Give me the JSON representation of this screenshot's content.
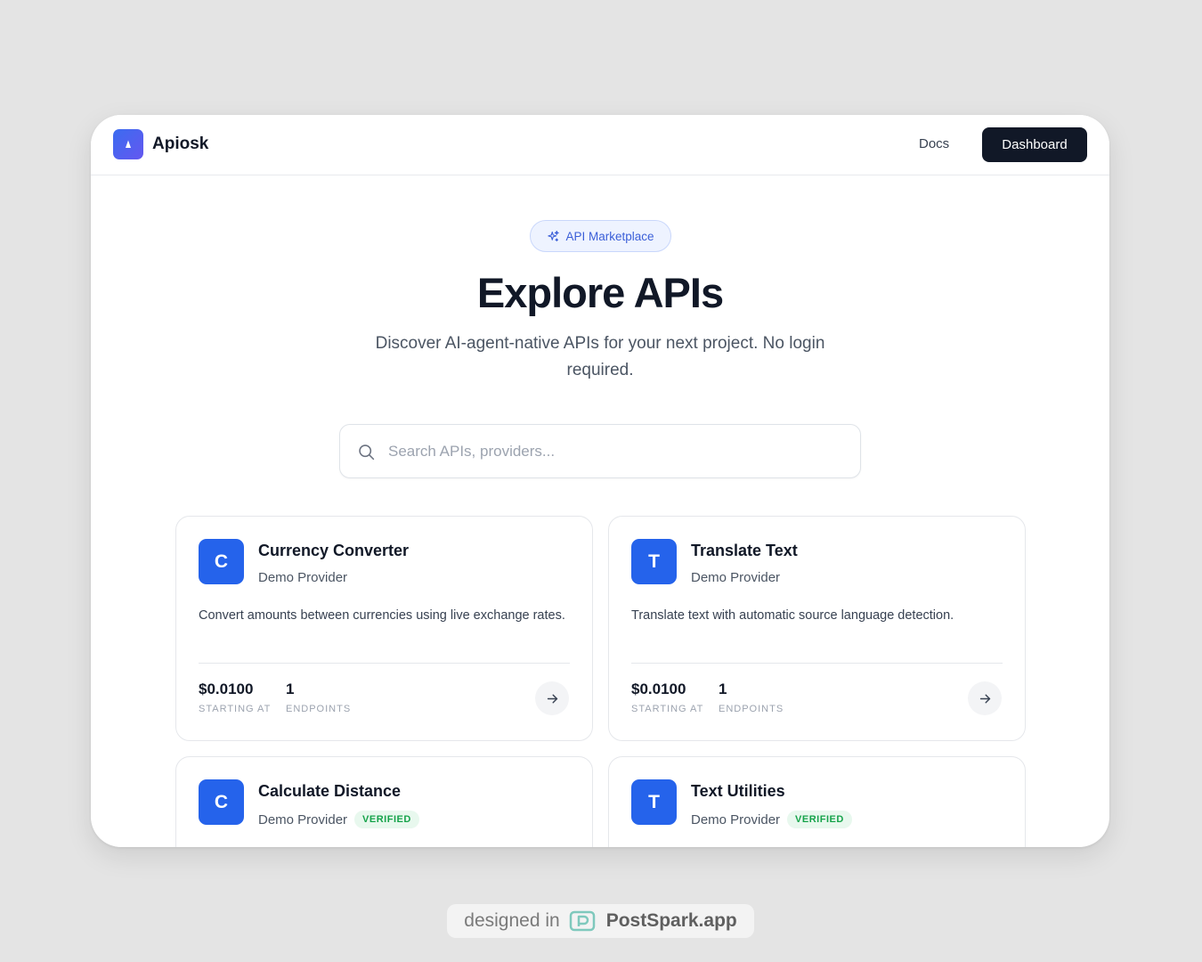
{
  "header": {
    "brand": "Apiosk",
    "docs_label": "Docs",
    "dashboard_label": "Dashboard"
  },
  "hero": {
    "badge": "API Marketplace",
    "title": "Explore APIs",
    "subtitle": "Discover AI-agent-native APIs for your next project. No login required."
  },
  "search": {
    "placeholder": "Search APIs, providers...",
    "value": ""
  },
  "cards": [
    {
      "initial": "C",
      "name": "Currency Converter",
      "provider": "Demo Provider",
      "description": "Convert amounts between currencies using live exchange rates.",
      "price": "$0.0100",
      "price_label": "STARTING AT",
      "endpoints": "1",
      "endpoints_label": "ENDPOINTS"
    },
    {
      "initial": "T",
      "name": "Translate Text",
      "provider": "Demo Provider",
      "description": "Translate text with automatic source language detection.",
      "price": "$0.0100",
      "price_label": "STARTING AT",
      "endpoints": "1",
      "endpoints_label": "ENDPOINTS"
    },
    {
      "initial": "C",
      "name": "Calculate Distance",
      "provider": "Demo Provider",
      "badge": "VERIFIED"
    },
    {
      "initial": "T",
      "name": "Text Utilities",
      "provider": "Demo Provider",
      "badge": "VERIFIED"
    }
  ],
  "footer": {
    "prefix": "designed in",
    "brand": "PostSpark.app"
  },
  "colors": {
    "accent": "#2563eb",
    "dark_button": "#111827",
    "verified": "#16a34a",
    "background": "#e4e4e4"
  }
}
